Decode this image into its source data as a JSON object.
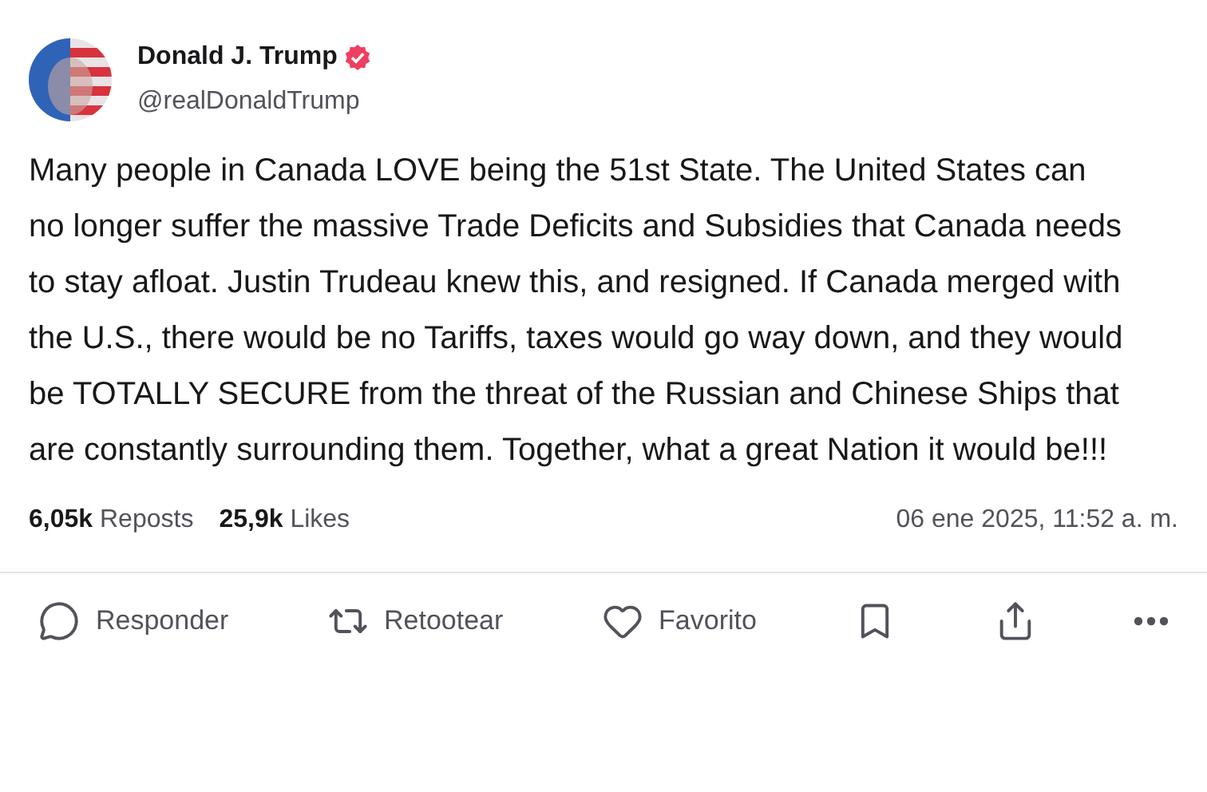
{
  "author": {
    "name": "Donald J. Trump",
    "verified": true,
    "handle": "@realDonaldTrump"
  },
  "post": {
    "text": "Many people in Canada LOVE being the 51st State. The United States can no longer suffer the massive Trade Deficits and Subsidies that Canada needs to stay afloat. Justin Trudeau knew this, and resigned. If Canada merged with the U.S., there would be no Tariffs, taxes would go way down, and they would be TOTALLY SECURE from the threat of the Russian and Chinese Ships that are constantly surrounding them. Together, what a great Nation it would be!!!"
  },
  "stats": [
    {
      "count": "6,05k",
      "label": "Reposts"
    },
    {
      "count": "25,9k",
      "label": "Likes"
    }
  ],
  "timestamp": "06 ene 2025, 11:52 a. m.",
  "actions": [
    {
      "kind": "reply",
      "label": "Responder"
    },
    {
      "kind": "repost",
      "label": "Retootear"
    },
    {
      "kind": "favorite",
      "label": "Favorito"
    },
    {
      "kind": "bookmark"
    },
    {
      "kind": "share"
    },
    {
      "kind": "more"
    }
  ]
}
